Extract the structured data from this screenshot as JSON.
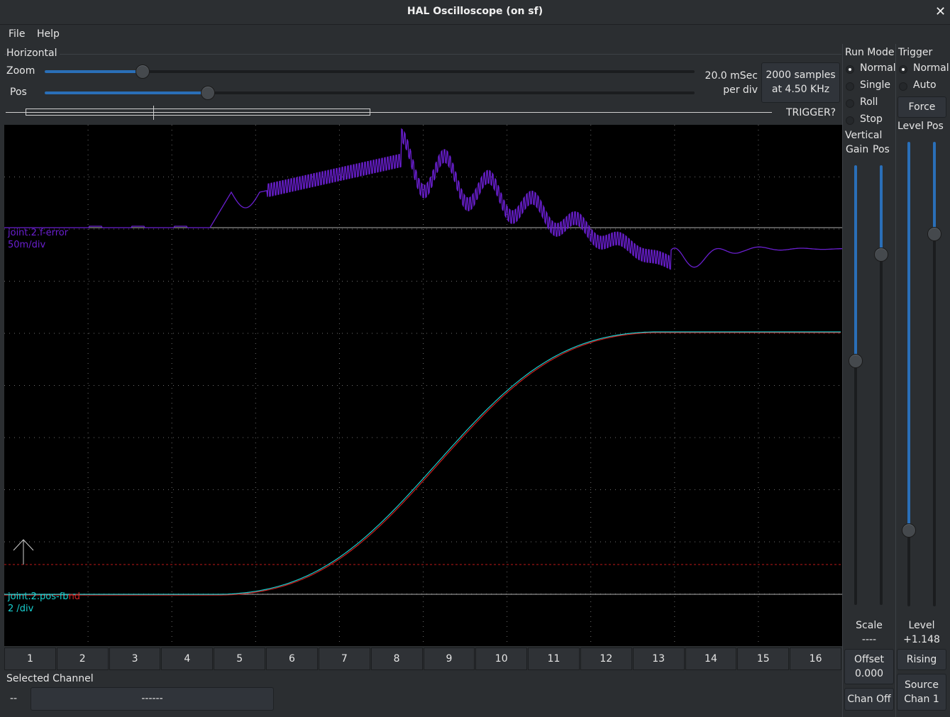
{
  "window": {
    "title": "HAL Oscilloscope (on sf)",
    "close_glyph": "✕"
  },
  "menu": {
    "file": "File",
    "help": "Help"
  },
  "horizontal": {
    "group_label": "Horizontal",
    "zoom_label": "Zoom",
    "pos_label": "Pos",
    "zoom_level": 0.15,
    "pos_level": 0.25,
    "time_per_div_line1": "20.0 mSec",
    "time_per_div_line2": "per div",
    "samples_line1": "2000 samples",
    "samples_line2": "at 4.50 KHz",
    "trigger_status": "TRIGGER?"
  },
  "run_mode": {
    "label": "Run Mode",
    "options": [
      "Normal",
      "Single",
      "Roll",
      "Stop"
    ],
    "selected": "Normal"
  },
  "trigger": {
    "label": "Trigger",
    "options": [
      "Normal",
      "Auto"
    ],
    "selected": "Normal",
    "force_label": "Force",
    "level_label": "Level",
    "pos_label": "Pos",
    "level_caption": "Level",
    "level_value": "+1.148",
    "edge_button": "Rising",
    "source_line1": "Source",
    "source_line2": "Chan  1"
  },
  "vertical": {
    "label": "Vertical",
    "gain_label": "Gain",
    "pos_label": "Pos",
    "scale_caption": "Scale",
    "scale_value": "----",
    "offset_caption": "Offset",
    "offset_value": "0.000",
    "chan_off_label": "Chan Off"
  },
  "scope_traces": [
    {
      "name": "joint.2.f-error",
      "scale": "50m/div",
      "color": "#6a1fd0"
    },
    {
      "name": "joint.2.pos-fb",
      "scale": "2 /div",
      "color": "#18d0d0",
      "overlap_suffix": "nd",
      "overlap_color": "#d02020"
    }
  ],
  "channels": [
    "1",
    "2",
    "3",
    "4",
    "5",
    "6",
    "7",
    "8",
    "9",
    "10",
    "11",
    "12",
    "13",
    "14",
    "15",
    "16"
  ],
  "selected_channel": {
    "label": "Selected Channel",
    "id": "--",
    "name": "------"
  },
  "colors": {
    "accent": "#2a6fb8",
    "background": "#2b2e31",
    "scope_bg": "#000000",
    "grid": "#6e6e6e"
  }
}
